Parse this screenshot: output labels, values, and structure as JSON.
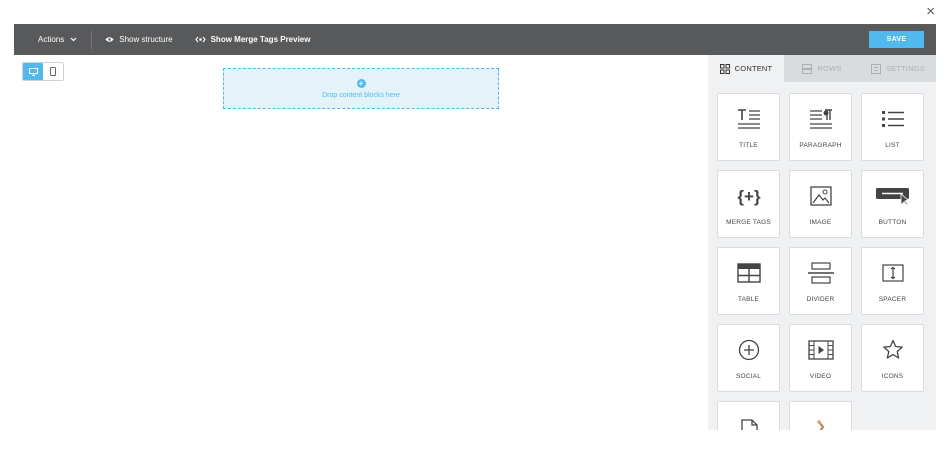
{
  "window": {
    "close_glyph": "×"
  },
  "toolbar": {
    "actions_label": "Actions",
    "show_structure_label": "Show structure",
    "merge_preview_label": "Show Merge Tags Preview",
    "save_label": "SAVE"
  },
  "canvas": {
    "drop_label": "Drop content blocks here",
    "drop_icon": "+"
  },
  "sidebar": {
    "tabs": [
      {
        "label": "CONTENT",
        "icon": "grid-icon"
      },
      {
        "label": "ROWS",
        "icon": "rows-icon"
      },
      {
        "label": "SETTINGS",
        "icon": "settings-icon"
      }
    ],
    "blocks": [
      {
        "label": "TITLE",
        "icon": "title-icon"
      },
      {
        "label": "PARAGRAPH",
        "icon": "paragraph-icon"
      },
      {
        "label": "LIST",
        "icon": "list-icon"
      },
      {
        "label": "MERGE TAGS",
        "icon": "merge-tags-icon"
      },
      {
        "label": "IMAGE",
        "icon": "image-icon"
      },
      {
        "label": "BUTTON",
        "icon": "button-icon"
      },
      {
        "label": "TABLE",
        "icon": "table-icon"
      },
      {
        "label": "DIVIDER",
        "icon": "divider-icon"
      },
      {
        "label": "SPACER",
        "icon": "spacer-icon"
      },
      {
        "label": "SOCIAL",
        "icon": "social-icon"
      },
      {
        "label": "VIDEO",
        "icon": "video-icon"
      },
      {
        "label": "ICONS",
        "icon": "icons-icon"
      },
      {
        "label": "",
        "icon": "html-icon"
      },
      {
        "label": "",
        "icon": "sticker-icon"
      }
    ]
  },
  "colors": {
    "toolbar": "#58595b",
    "accent": "#52b9ee",
    "panel": "#f0f1f2"
  }
}
